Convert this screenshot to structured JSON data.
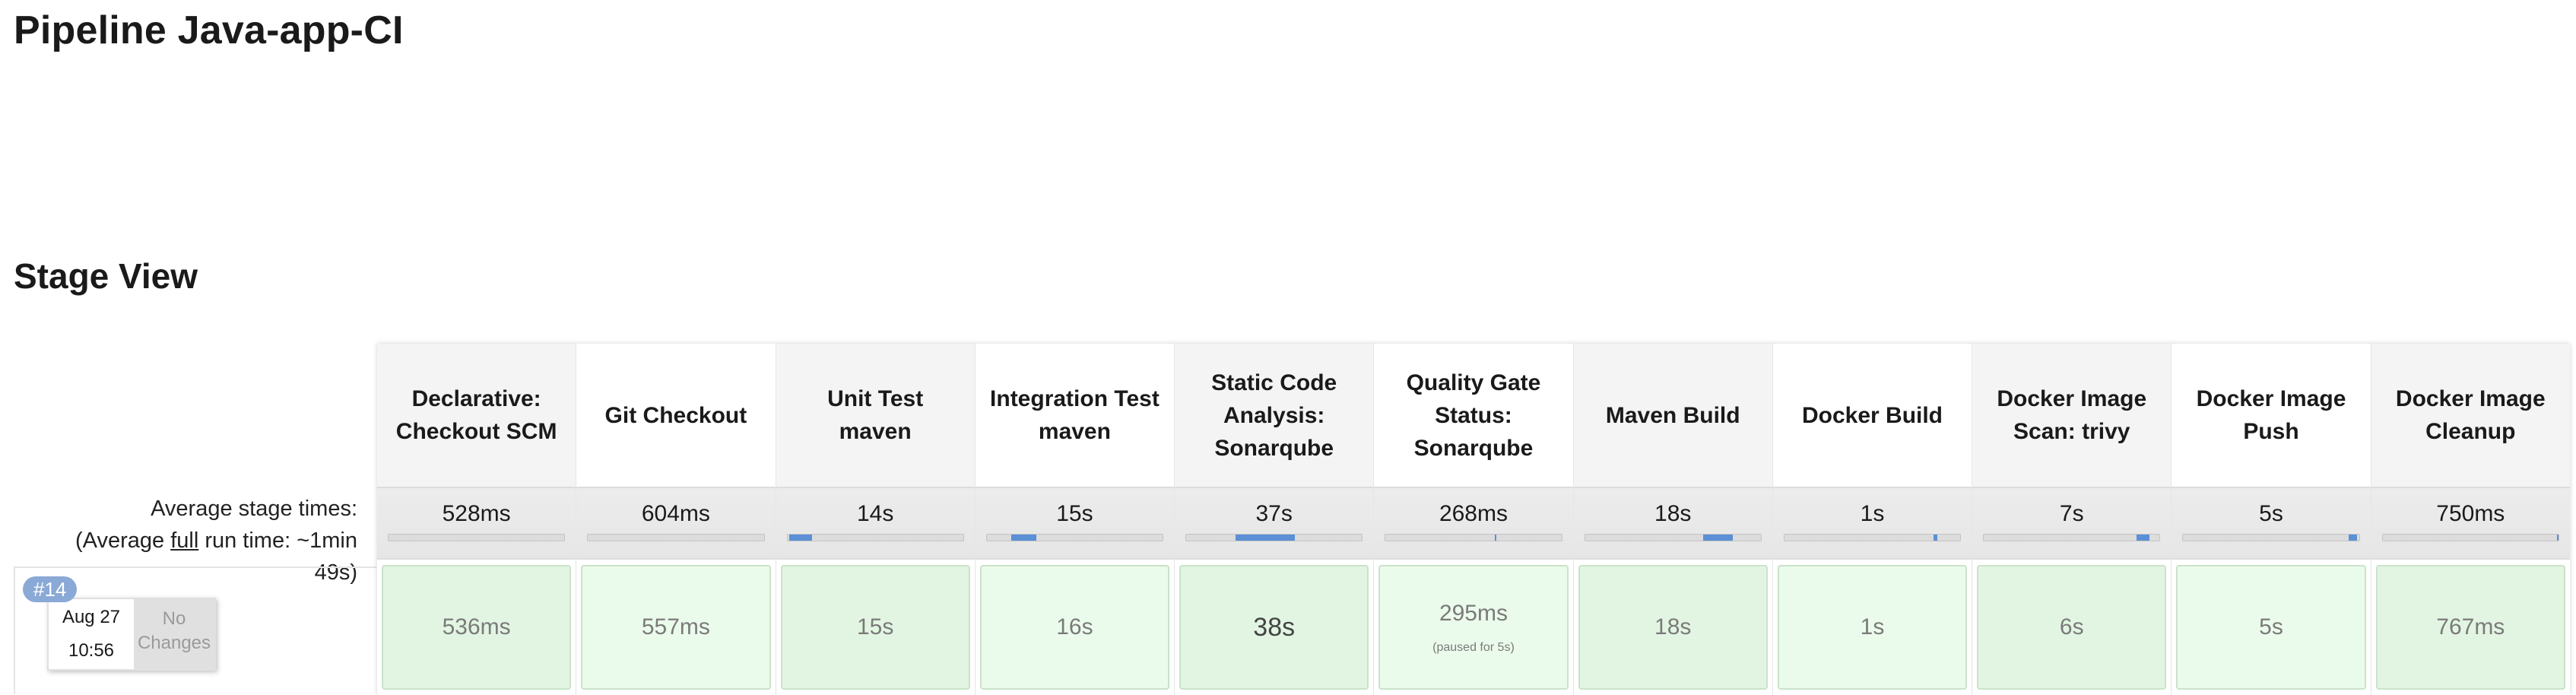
{
  "page": {
    "title": "Pipeline Java-app-CI",
    "section_title": "Stage View"
  },
  "summary": {
    "avg_label_line1": "Average stage times:",
    "avg_label_prefix": "(Average ",
    "avg_label_link": "full",
    "avg_label_suffix": " run time: ~1min",
    "avg_label_line3": "49s)"
  },
  "run": {
    "badge": "#14",
    "date": "Aug 27",
    "time": "10:56",
    "changes": "No Changes"
  },
  "stages": [
    {
      "name": "Declarative: Checkout SCM",
      "avg": "528ms",
      "bar_start": 0.0,
      "bar_fraction": 0.0,
      "run_time": "536ms",
      "note": ""
    },
    {
      "name": "Git Checkout",
      "avg": "604ms",
      "bar_start": 0.0,
      "bar_fraction": 0.0,
      "run_time": "557ms",
      "note": ""
    },
    {
      "name": "Unit Test maven",
      "avg": "14s",
      "bar_start": 0.01,
      "bar_fraction": 0.13,
      "run_time": "15s",
      "note": ""
    },
    {
      "name": "Integration Test maven",
      "avg": "15s",
      "bar_start": 0.14,
      "bar_fraction": 0.14,
      "run_time": "16s",
      "note": ""
    },
    {
      "name": "Static Code Analysis: Sonarqube",
      "avg": "37s",
      "bar_start": 0.28,
      "bar_fraction": 0.34,
      "run_time": "38s",
      "note": ""
    },
    {
      "name": "Quality Gate Status: Sonarqube",
      "avg": "268ms",
      "bar_start": 0.62,
      "bar_fraction": 0.01,
      "run_time": "295ms",
      "note": "(paused for 5s)"
    },
    {
      "name": "Maven Build",
      "avg": "18s",
      "bar_start": 0.67,
      "bar_fraction": 0.17,
      "run_time": "18s",
      "note": ""
    },
    {
      "name": "Docker Build",
      "avg": "1s",
      "bar_start": 0.85,
      "bar_fraction": 0.02,
      "run_time": "1s",
      "note": ""
    },
    {
      "name": "Docker Image Scan: trivy",
      "avg": "7s",
      "bar_start": 0.87,
      "bar_fraction": 0.07,
      "run_time": "6s",
      "note": ""
    },
    {
      "name": "Docker Image Push",
      "avg": "5s",
      "bar_start": 0.94,
      "bar_fraction": 0.05,
      "run_time": "5s",
      "note": ""
    },
    {
      "name": "Docker Image Cleanup",
      "avg": "750ms",
      "bar_start": 0.99,
      "bar_fraction": 0.01,
      "run_time": "767ms",
      "note": ""
    }
  ],
  "colors": {
    "success_fill_odd": "#e2f5e2",
    "success_fill_even": "#ebfbeb",
    "progress_bar": "#5b8fd6",
    "run_badge": "#8aa9d6"
  }
}
